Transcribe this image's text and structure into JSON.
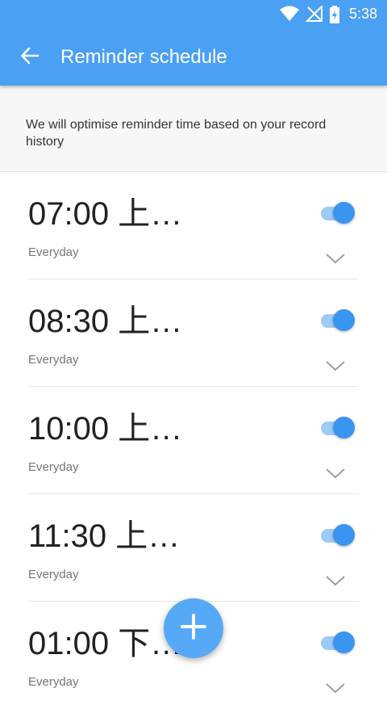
{
  "status_bar": {
    "time": "5:38",
    "icons": [
      "wifi-icon",
      "no-signal-icon",
      "battery-charging-icon"
    ]
  },
  "app_bar": {
    "title": "Reminder schedule",
    "back_icon": "arrow-left-icon",
    "color": "#4aa0f3"
  },
  "info": {
    "text": "We will optimise reminder time based on your record history"
  },
  "reminders": [
    {
      "time": "07:00 上…",
      "repeat": "Everyday",
      "enabled": true
    },
    {
      "time": "08:30 上…",
      "repeat": "Everyday",
      "enabled": true
    },
    {
      "time": "10:00 上…",
      "repeat": "Everyday",
      "enabled": true
    },
    {
      "time": "11:30 上…",
      "repeat": "Everyday",
      "enabled": true
    },
    {
      "time": "01:00 下…",
      "repeat": "Everyday",
      "enabled": true
    }
  ],
  "fab": {
    "icon": "plus-icon",
    "color": "#56a9f6"
  }
}
